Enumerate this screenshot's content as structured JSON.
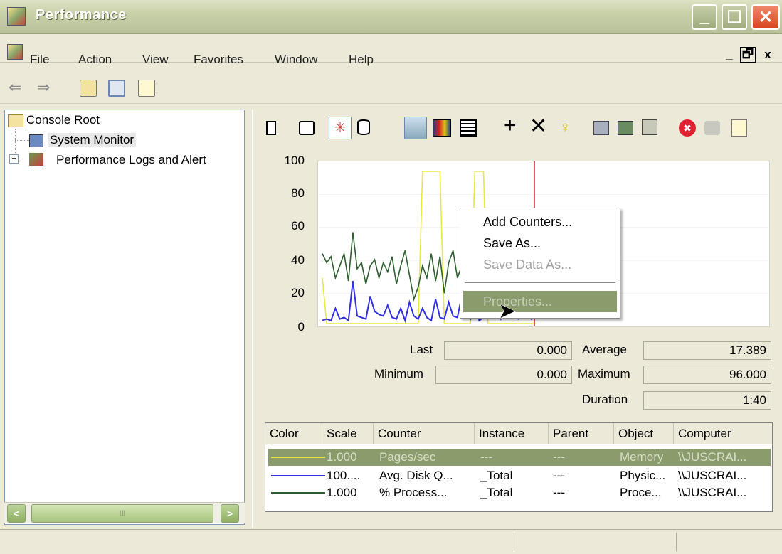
{
  "window": {
    "title": "Performance"
  },
  "menu": {
    "items": [
      "File",
      "Action",
      "View",
      "Favorites",
      "Window",
      "Help"
    ],
    "mdi": [
      "_",
      "🗗",
      "x"
    ]
  },
  "tree": {
    "root": "Console Root",
    "items": [
      "System Monitor",
      "Performance Logs and Alert"
    ]
  },
  "chart_data": {
    "type": "line",
    "yticks": [
      "100",
      "80",
      "60",
      "40",
      "20",
      "0"
    ],
    "ylim": [
      0,
      100
    ],
    "series": [
      {
        "color": "#e8e840",
        "values": [
          30,
          0,
          0,
          0,
          0,
          0,
          0,
          0,
          0,
          0,
          0,
          0,
          0,
          0,
          0,
          0,
          0,
          0,
          0,
          0,
          0,
          0,
          0,
          100,
          100,
          100,
          100,
          100,
          0,
          0,
          0,
          0,
          0,
          0,
          0,
          100,
          100,
          100,
          0,
          0,
          0,
          0,
          0,
          0,
          0,
          0,
          0,
          0,
          0,
          0
        ]
      },
      {
        "color": "#3030e0",
        "values": [
          2,
          3,
          2,
          10,
          3,
          4,
          2,
          28,
          5,
          4,
          3,
          18,
          8,
          6,
          5,
          12,
          4,
          3,
          10,
          2,
          14,
          5,
          3,
          10,
          4,
          2,
          16,
          4,
          3,
          14,
          5,
          4,
          18,
          6,
          3,
          16,
          2,
          4,
          14,
          5,
          10,
          3,
          8,
          16,
          4,
          3,
          6,
          14,
          3,
          4
        ]
      },
      {
        "color": "#2f5f2f",
        "values": [
          46,
          40,
          44,
          30,
          38,
          46,
          28,
          60,
          36,
          40,
          26,
          38,
          42,
          30,
          40,
          34,
          44,
          26,
          38,
          48,
          32,
          16,
          24,
          38,
          30,
          46,
          28,
          44,
          20,
          40,
          48,
          30,
          38,
          36,
          44,
          50,
          46,
          28,
          40,
          36,
          42,
          44,
          38,
          40,
          36,
          28,
          30,
          40,
          42,
          36
        ]
      }
    ]
  },
  "stats": {
    "last_label": "Last",
    "last": "0.000",
    "avg_label": "Average",
    "avg": "17.389",
    "min_label": "Minimum",
    "min": "0.000",
    "max_label": "Maximum",
    "max": "96.000",
    "dur_label": "Duration",
    "dur": "1:40"
  },
  "legend": {
    "headers": [
      "Color",
      "Scale",
      "Counter",
      "Instance",
      "Parent",
      "Object",
      "Computer"
    ],
    "rows": [
      {
        "color": "#e8e840",
        "scale": "1.000",
        "counter": "Pages/sec",
        "instance": "---",
        "parent": "---",
        "object": "Memory",
        "computer": "\\\\JUSCRAI..."
      },
      {
        "color": "#3030e0",
        "scale": "100....",
        "counter": "Avg. Disk Q...",
        "instance": "_Total",
        "parent": "---",
        "object": "Physic...",
        "computer": "\\\\JUSCRAI..."
      },
      {
        "color": "#2f5f2f",
        "scale": "1.000",
        "counter": "% Process...",
        "instance": "_Total",
        "parent": "---",
        "object": "Proce...",
        "computer": "\\\\JUSCRAI..."
      }
    ]
  },
  "context_menu": {
    "add_counters": "Add Counters...",
    "save_as": "Save As...",
    "save_data_as": "Save Data As...",
    "properties": "Properties..."
  }
}
